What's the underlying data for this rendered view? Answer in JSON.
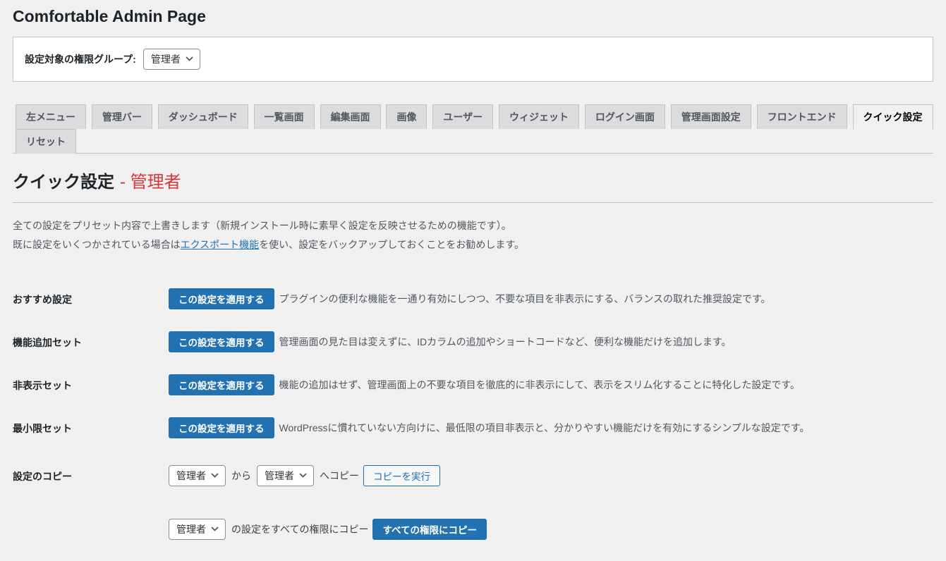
{
  "page": {
    "title": "Comfortable Admin Page"
  },
  "role_selector": {
    "label": "設定対象の権限グループ:",
    "value": "管理者"
  },
  "tabs": [
    {
      "label": "左メニュー",
      "active": false
    },
    {
      "label": "管理バー",
      "active": false
    },
    {
      "label": "ダッシュボード",
      "active": false
    },
    {
      "label": "一覧画面",
      "active": false
    },
    {
      "label": "編集画面",
      "active": false
    },
    {
      "label": "画像",
      "active": false
    },
    {
      "label": "ユーザー",
      "active": false
    },
    {
      "label": "ウィジェット",
      "active": false
    },
    {
      "label": "ログイン画面",
      "active": false
    },
    {
      "label": "管理画面設定",
      "active": false
    },
    {
      "label": "フロントエンド",
      "active": false
    },
    {
      "label": "クイック設定",
      "active": true
    },
    {
      "label": "リセット",
      "active": false
    }
  ],
  "section": {
    "title": "クイック設定",
    "title_suffix": "- 管理者",
    "description_line1": "全ての設定をプリセット内容で上書きします（新規インストール時に素早く設定を反映させるための機能です）。",
    "description_line2_prefix": "既に設定をいくつかされている場合は",
    "description_link": "エクスポート機能",
    "description_line2_suffix": "を使い、設定をバックアップしておくことをお勧めします。"
  },
  "presets": [
    {
      "label": "おすすめ設定",
      "button": "この設定を適用する",
      "description": "プラグインの便利な機能を一通り有効にしつつ、不要な項目を非表示にする、バランスの取れた推奨設定です。"
    },
    {
      "label": "機能追加セット",
      "button": "この設定を適用する",
      "description": "管理画面の見た目は変えずに、IDカラムの追加やショートコードなど、便利な機能だけを追加します。"
    },
    {
      "label": "非表示セット",
      "button": "この設定を適用する",
      "description": "機能の追加はせず、管理画面上の不要な項目を徹底的に非表示にして、表示をスリム化することに特化した設定です。"
    },
    {
      "label": "最小限セット",
      "button": "この設定を適用する",
      "description": "WordPressに慣れていない方向けに、最低限の項目非表示と、分かりやすい機能だけを有効にするシンプルな設定です。"
    }
  ],
  "copy_settings": {
    "label": "設定のコピー",
    "from_value": "管理者",
    "between_text": "から",
    "to_value": "管理者",
    "after_text": "へコピー",
    "execute_button": "コピーを実行",
    "all_source_value": "管理者",
    "all_text": "の設定をすべての権限にコピー",
    "all_button": "すべての権限にコピー"
  },
  "colors": {
    "accent": "#2271b1",
    "heading_red": "#d63638",
    "page_bg": "#f0f0f1",
    "tab_inactive_bg": "#dcdcde",
    "border": "#c3c4c7"
  }
}
